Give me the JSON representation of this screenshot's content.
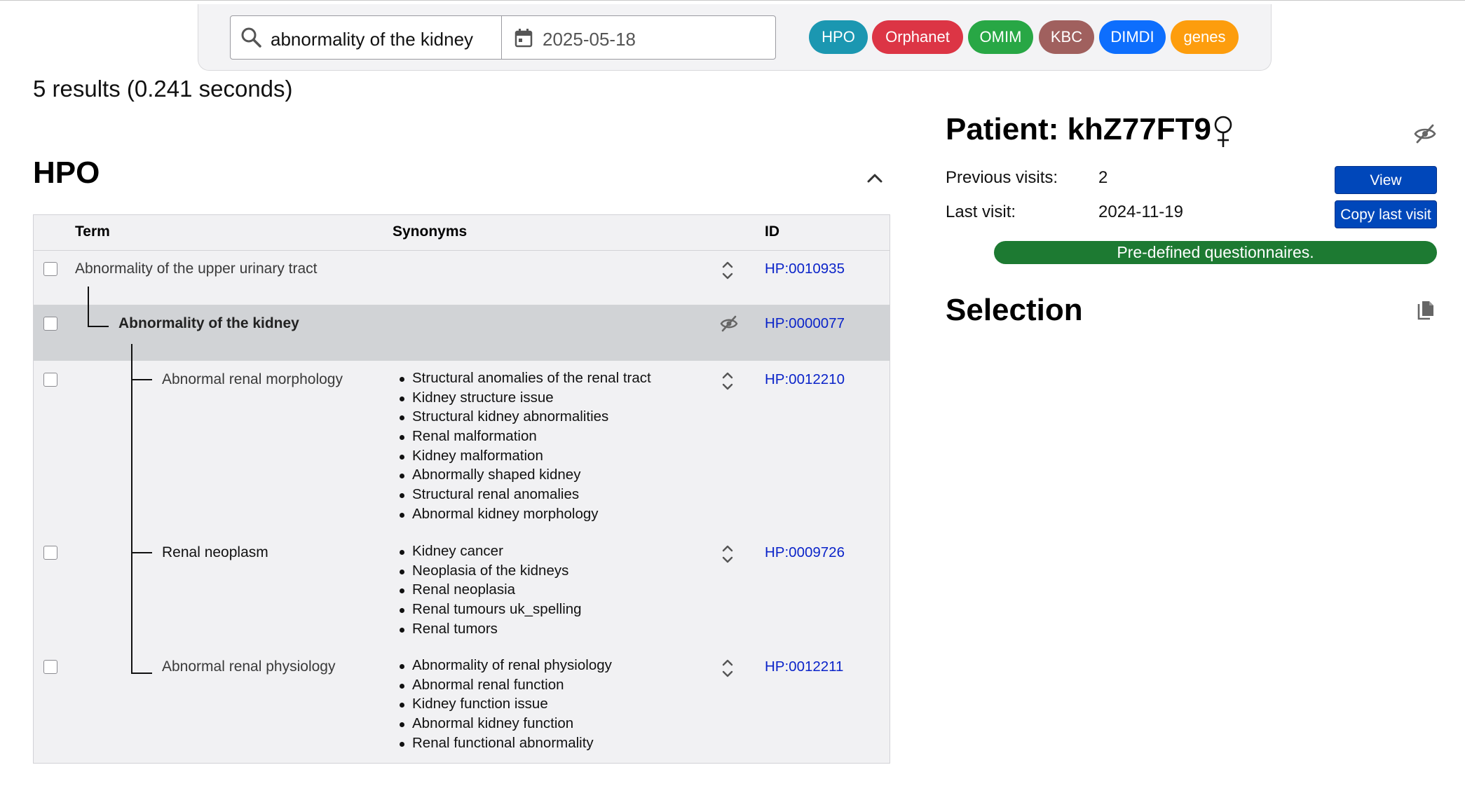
{
  "search": {
    "query": "abnormality of the kidney",
    "date": "2025-05-18"
  },
  "sources": {
    "chips": [
      "HPO",
      "Orphanet",
      "OMIM",
      "KBC",
      "DIMDI",
      "genes"
    ],
    "colors": {
      "HPO": "#1b97b1",
      "Orphanet": "#dc3545",
      "OMIM": "#28a745",
      "KBC": "#a0605e",
      "DIMDI": "#0d6efd",
      "genes": "#fd9d0d"
    }
  },
  "results": {
    "summary": "5 results (0.241 seconds)"
  },
  "hpo_section": {
    "title": "HPO",
    "columns": {
      "term": "Term",
      "synonyms": "Synonyms",
      "id": "ID"
    },
    "rows": [
      {
        "term": "Abnormality of the upper urinary tract",
        "synonyms": [],
        "id": "HP:0010935"
      },
      {
        "term": "Abnormality of the kidney",
        "synonyms": [],
        "id": "HP:0000077"
      },
      {
        "term": "Abnormal renal morphology",
        "synonyms": [
          "Structural anomalies of the renal tract",
          "Kidney structure issue",
          "Structural kidney abnormalities",
          "Renal malformation",
          "Kidney malformation",
          "Abnormally shaped kidney",
          "Structural renal anomalies",
          "Abnormal kidney morphology"
        ],
        "id": "HP:0012210"
      },
      {
        "term": "Renal neoplasm",
        "synonyms": [
          "Kidney cancer",
          "Neoplasia of the kidneys",
          "Renal neoplasia",
          "Renal tumours uk_spelling",
          "Renal tumors"
        ],
        "id": "HP:0009726"
      },
      {
        "term": "Abnormal renal physiology",
        "synonyms": [
          "Abnormality of renal physiology",
          "Abnormal renal function",
          "Kidney function issue",
          "Abnormal kidney function",
          "Renal functional abnormality"
        ],
        "id": "HP:0012211"
      }
    ]
  },
  "patient": {
    "title": "Patient: khZ77FT9",
    "previous_visits_label": "Previous visits:",
    "previous_visits_value": "2",
    "last_visit_label": "Last visit:",
    "last_visit_value": "2024-11-19",
    "view_button": "View",
    "copy_last_visit_button": "Copy last visit",
    "questionnaires_button": "Pre-defined questionnaires."
  },
  "selection": {
    "title": "Selection"
  },
  "colors": {
    "link": "#0b24c9",
    "primary_button": "#0047ba",
    "success": "#1d7a32",
    "selected_row": "#d1d3d6"
  }
}
